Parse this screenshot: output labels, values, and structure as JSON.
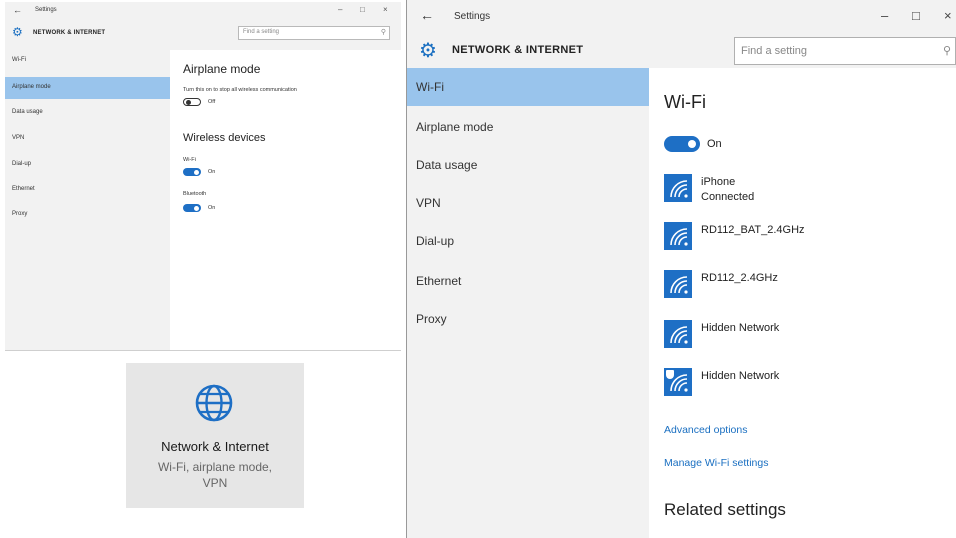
{
  "small_window": {
    "title": "Settings",
    "back_glyph": "←",
    "controls": [
      "–",
      "□",
      "×"
    ],
    "heading": "NETWORK & INTERNET",
    "search_placeholder": "Find a setting",
    "nav": [
      {
        "label": "Wi-Fi",
        "selected": false
      },
      {
        "label": "Airplane mode",
        "selected": true
      },
      {
        "label": "Data usage",
        "selected": false
      },
      {
        "label": "VPN",
        "selected": false
      },
      {
        "label": "Dial-up",
        "selected": false
      },
      {
        "label": "Ethernet",
        "selected": false
      },
      {
        "label": "Proxy",
        "selected": false
      }
    ],
    "airplane_title": "Airplane mode",
    "airplane_desc": "Turn this on to stop all wireless communication",
    "airplane_state": "Off",
    "wireless_title": "Wireless devices",
    "wifi_label": "Wi-Fi",
    "wifi_state": "On",
    "bluetooth_label": "Bluetooth",
    "bluetooth_state": "On"
  },
  "tile": {
    "icon": "globe-icon",
    "title": "Network & Internet",
    "subtitle_line1": "Wi-Fi, airplane mode,",
    "subtitle_line2": "VPN"
  },
  "main_window": {
    "title": "Settings",
    "back_glyph": "←",
    "controls": [
      "–",
      "□",
      "×"
    ],
    "heading": "NETWORK & INTERNET",
    "search_placeholder": "Find a setting",
    "nav": [
      {
        "label": "Wi-Fi",
        "selected": true
      },
      {
        "label": "Airplane mode",
        "selected": false
      },
      {
        "label": "Data usage",
        "selected": false
      },
      {
        "label": "VPN",
        "selected": false
      },
      {
        "label": "Dial-up",
        "selected": false
      },
      {
        "label": "Ethernet",
        "selected": false
      },
      {
        "label": "Proxy",
        "selected": false
      }
    ],
    "wifi_title": "Wi-Fi",
    "wifi_state": "On",
    "networks": [
      {
        "name": "iPhone",
        "status": "Connected",
        "secured_badge": false
      },
      {
        "name": "RD112_BAT_2.4GHz",
        "status": "",
        "secured_badge": false
      },
      {
        "name": "RD112_2.4GHz",
        "status": "",
        "secured_badge": false
      },
      {
        "name": "Hidden Network",
        "status": "",
        "secured_badge": false
      },
      {
        "name": "Hidden Network",
        "status": "",
        "secured_badge": true
      }
    ],
    "advanced_link": "Advanced options",
    "manage_link": "Manage Wi-Fi settings",
    "related_title": "Related settings"
  },
  "colors": {
    "accent": "#1e6fc5",
    "selected_nav": "#99c4ec",
    "nav_bg": "#f2f2f2",
    "tile_bg": "#e6e6e6"
  }
}
